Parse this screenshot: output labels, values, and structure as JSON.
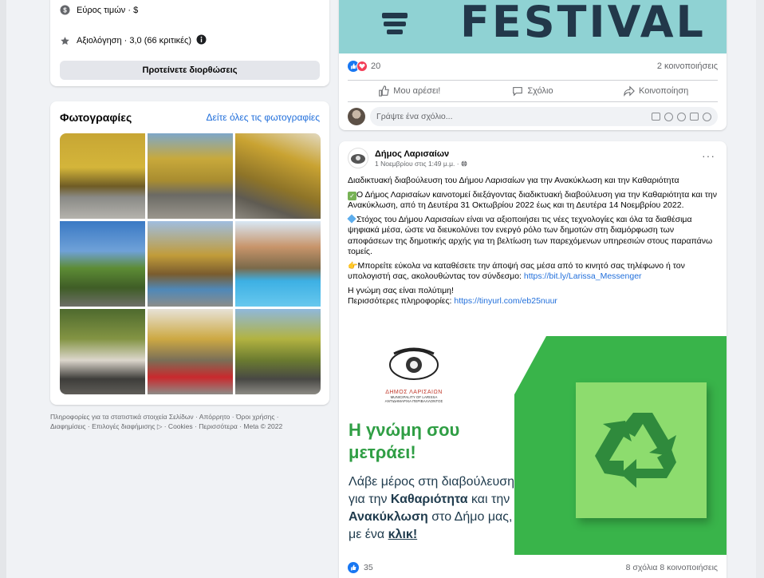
{
  "about": {
    "price_range": "Εύρος τιμών · $",
    "rating": "Αξιολόγηση · 3,0 (66 κριτικές)",
    "suggest_edits": "Προτείνετε διορθώσεις"
  },
  "photos": {
    "title": "Φωτογραφίες",
    "see_all": "Δείτε όλες τις φωτογραφίες"
  },
  "footer": {
    "text": "Πληροφορίες για τα στατιστικά στοιχεία Σελίδων · Απόρρητο · Όροι χρήσης · Διαφημίσεις · Επιλογές διαφήμισης ▷ · Cookies · Περισσότερα · Meta © 2022"
  },
  "post1": {
    "banner_text": "FESTIVAL",
    "reaction_count": "20",
    "shares": "2 κοινοποιήσεις",
    "like_label": "Μου αρέσει!",
    "comment_label": "Σχόλιο",
    "share_label": "Κοινοποίηση",
    "comment_placeholder": "Γράψτε ένα σχόλιο..."
  },
  "post2": {
    "page_name": "Δήμος Λαρισαίων",
    "date": "1 Νοεμβρίου στις 1:49 μ.μ. · ",
    "more": "···",
    "p1": "Διαδικτυακή διαβούλευση του Δήμου Λαρισαίων για την Ανακύκλωση και την Καθαριότητα",
    "p2": "Ο Δήμος Λαρισαίων καινοτομεί διεξάγοντας διαδικτυακή διαβούλευση για την Καθαριότητα και την Ανακύκλωση, από τη Δευτέρα 31 Οκτωβρίου 2022 έως και τη Δευτέρα 14 Νοεμβρίου 2022.",
    "p3": "Στόχος του Δήμου Λαρισαίων είναι να αξιοποιήσει τις νέες τεχνολογίες και όλα τα διαθέσιμα ψηφιακά μέσα, ώστε να διευκολύνει τον ενεργό ρόλο των δημοτών στη διαμόρφωση των αποφάσεων της δημοτικής αρχής για τη βελτίωση των παρεχόμενων υπηρεσιών στους παραπάνω τομείς.",
    "p4": "Μπορείτε εύκολα να καταθέσετε την άποψή σας μέσα από το κινητό σας τηλέφωνο ή τον υπολογιστή σας, ακολουθώντας τον σύνδεσμο: ",
    "p4_link": "https://bit.ly/Larissa_Messenger",
    "p5": "Η γνώμη σας είναι πολύτιμη!",
    "p6": "Περισσότερες πληροφορίες: ",
    "p6_link": "https://tinyurl.com/eb25nuur",
    "graphic_logo_line1": "ΔΗΜΟΣ ΛΑΡΙΣΑΙΩΝ",
    "graphic_logo_line2": "MUNICIPALITY OF LARISSA",
    "graphic_logo_line3": "ΑΝΤΙΔΗΜΑΡΧΙΑ ΠΕΡΙΒΑΛΛΟΝΤΟΣ",
    "graphic_h1_line1": "Η γνώμη σου",
    "graphic_h1_line2": "μετράει!",
    "graphic_h2_a": "Λάβε μέρος στη διαβούλευση",
    "graphic_h2_b": "για την ",
    "graphic_h2_b_bold": "Καθαριότητα",
    "graphic_h2_b_end": " και την",
    "graphic_h2_c_bold": "Ανακύκλωση",
    "graphic_h2_c_end": " στο Δήμο μας,",
    "graphic_h2_d": "με ένα ",
    "graphic_h2_d_bold": "κλικ!",
    "reaction_count": "35",
    "stats": "8 σχόλια  8 κοινοποιήσεις"
  },
  "colors": {
    "link_blue": "#216fdb",
    "fb_blue": "#1877f2",
    "graphic_green": "#39b44a",
    "heading_green": "#2f9e44"
  }
}
